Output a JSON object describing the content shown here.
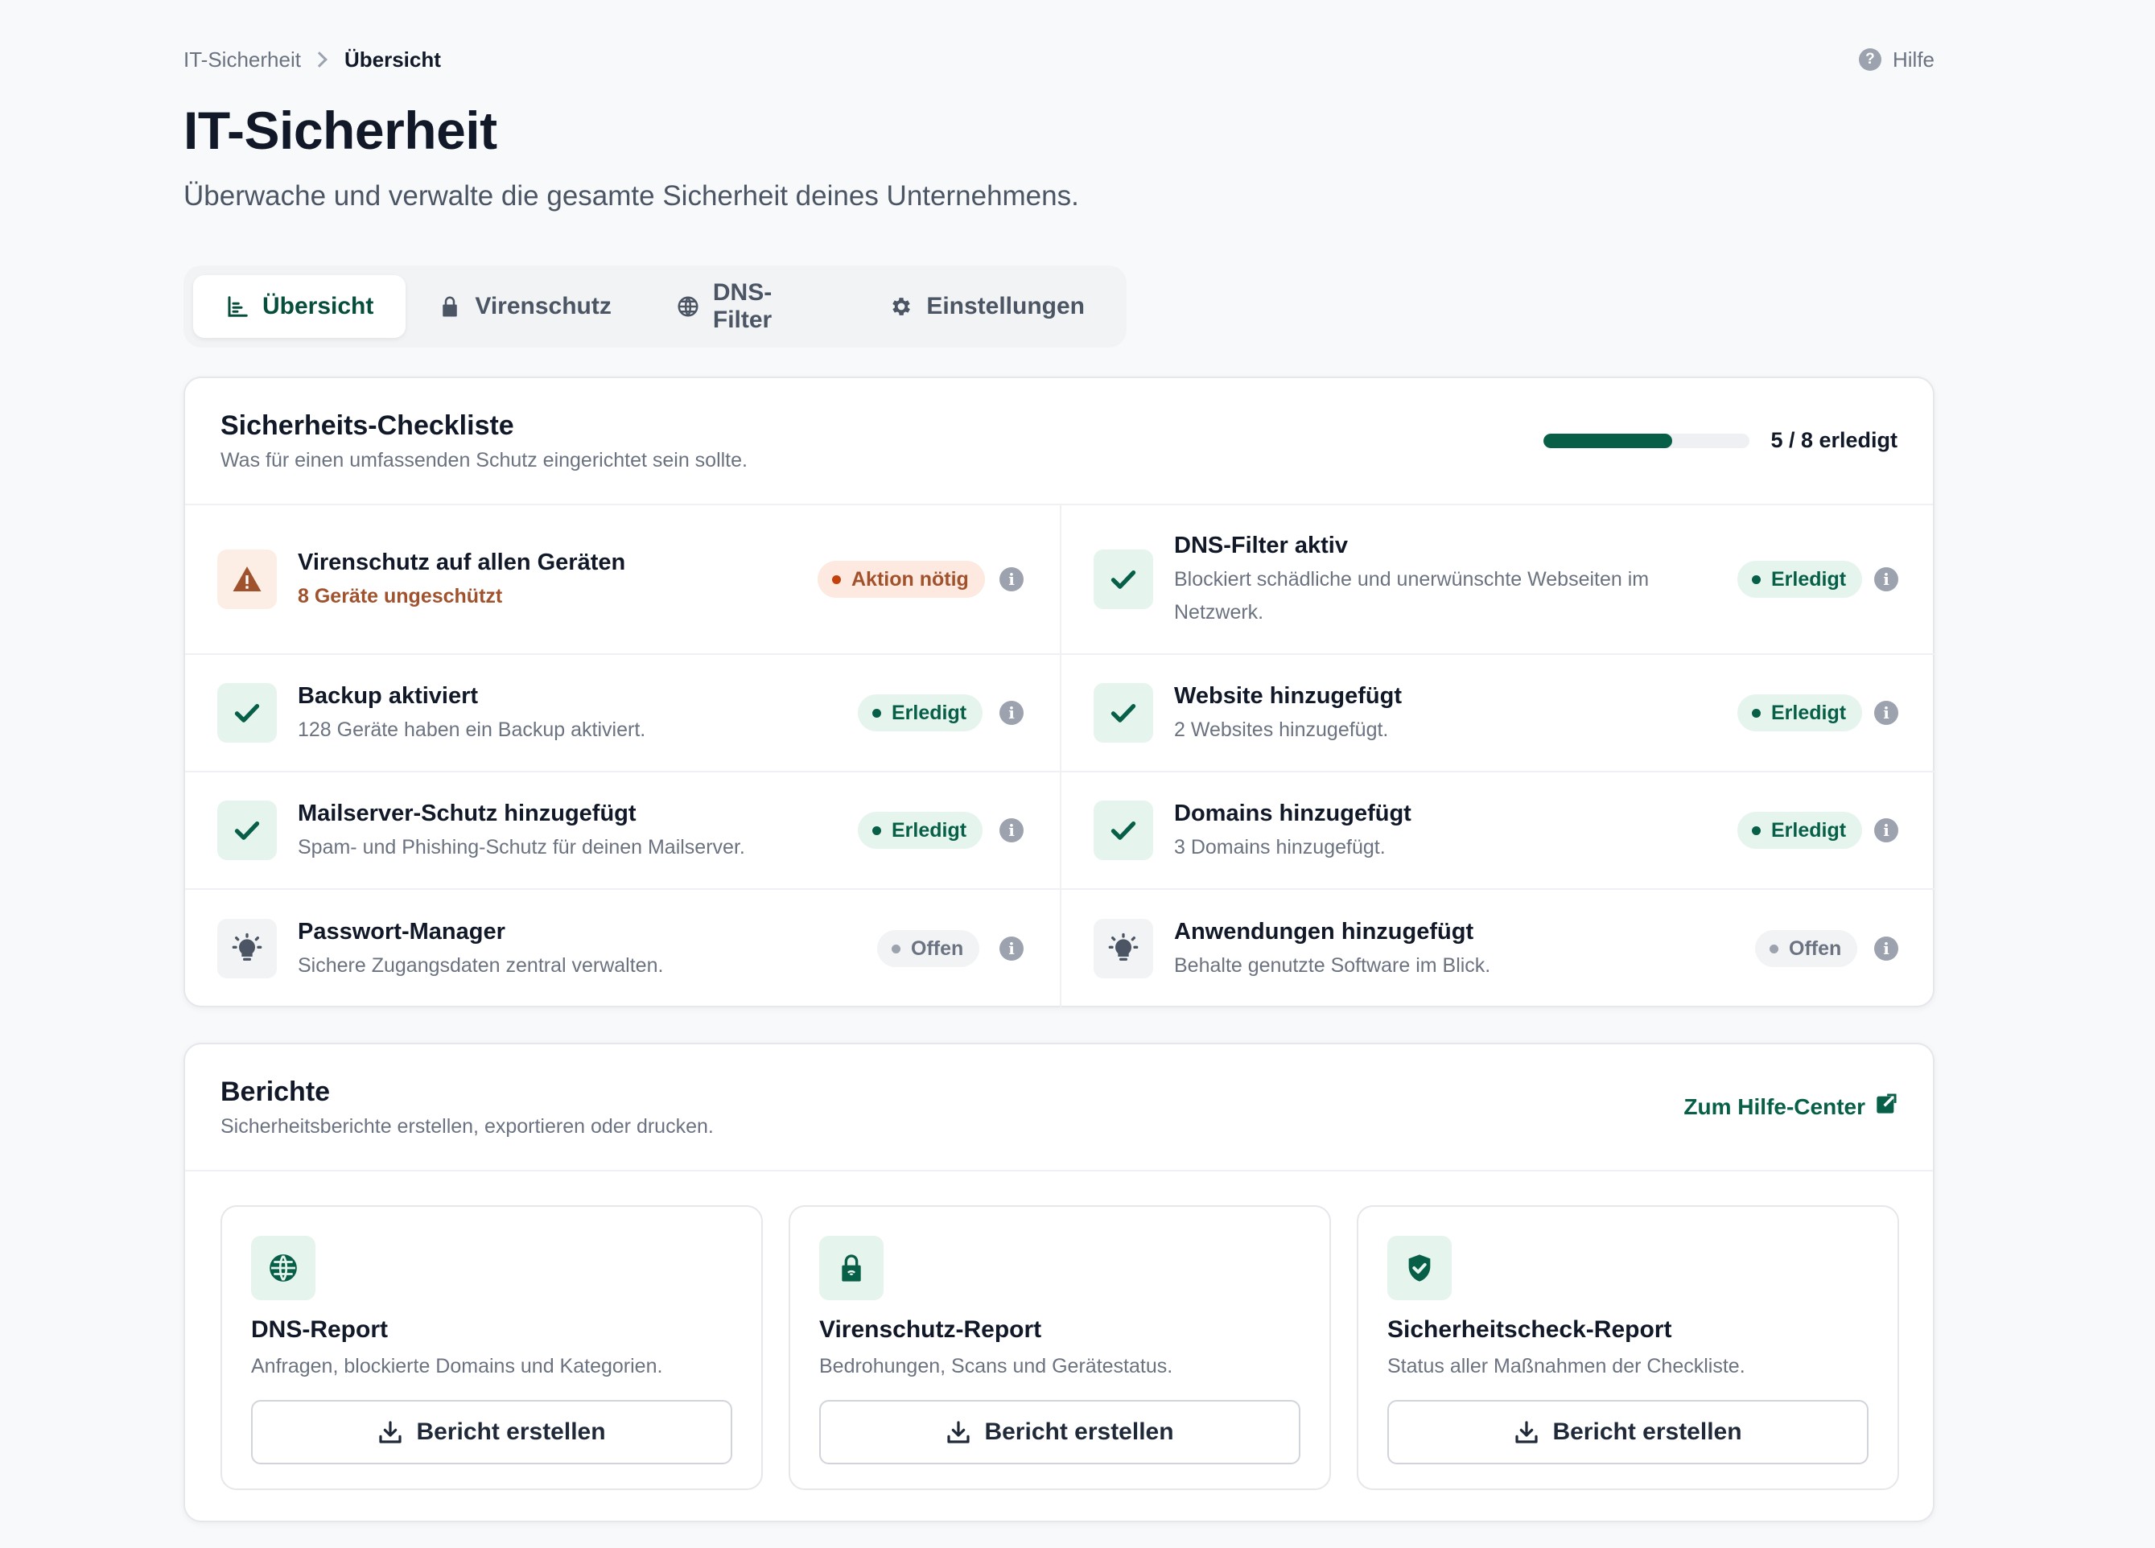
{
  "breadcrumb": {
    "parent": "IT-Sicherheit",
    "current": "Übersicht"
  },
  "help": {
    "label": "Hilfe"
  },
  "page": {
    "title": "IT-Sicherheit",
    "subtitle": "Überwache und verwalte die gesamte Sicherheit deines Unternehmens."
  },
  "tabs": [
    {
      "label": "Übersicht",
      "icon": "chart-bars-icon",
      "active": true
    },
    {
      "label": "Virenschutz",
      "icon": "lock-icon",
      "active": false
    },
    {
      "label": "DNS-Filter",
      "icon": "globe-icon",
      "active": false
    },
    {
      "label": "Einstellungen",
      "icon": "gear-icon",
      "active": false
    }
  ],
  "checklist": {
    "title": "Sicherheits-Checkliste",
    "description": "Was für einen umfassenden Schutz eingerichtet sein sollte.",
    "progress": {
      "done": 5,
      "total": 8,
      "label": "5 / 8 erledigt"
    },
    "items": [
      {
        "title": "Virenschutz auf allen Geräten",
        "desc": "8 Geräte ungeschützt",
        "status": "warn",
        "badge": "Aktion nötig",
        "icon": "warning-icon"
      },
      {
        "title": "DNS-Filter aktiv",
        "desc": "Blockiert schädliche und unerwünschte Webseiten im Netzwerk.",
        "status": "done",
        "badge": "Erledigt",
        "icon": "check-icon"
      },
      {
        "title": "Backup aktiviert",
        "desc": "128 Geräte haben ein Backup aktiviert.",
        "status": "done",
        "badge": "Erledigt",
        "icon": "check-icon"
      },
      {
        "title": "Website hinzugefügt",
        "desc": "2 Websites hinzugefügt.",
        "status": "done",
        "badge": "Erledigt",
        "icon": "check-icon"
      },
      {
        "title": "Mailserver-Schutz hinzugefügt",
        "desc": "Spam- und Phishing-Schutz für deinen Mailserver.",
        "status": "done",
        "badge": "Erledigt",
        "icon": "check-icon"
      },
      {
        "title": "Domains hinzugefügt",
        "desc": "3 Domains hinzugefügt.",
        "status": "done",
        "badge": "Erledigt",
        "icon": "check-icon"
      },
      {
        "title": "Passwort-Manager",
        "desc": "Sichere Zugangsdaten zentral verwalten.",
        "status": "open",
        "badge": "Offen",
        "icon": "lightbulb-icon"
      },
      {
        "title": "Anwendungen hinzugefügt",
        "desc": "Behalte genutzte Software im Blick.",
        "status": "open",
        "badge": "Offen",
        "icon": "lightbulb-icon"
      }
    ]
  },
  "reports": {
    "title": "Berichte",
    "description": "Sicherheitsberichte erstellen, exportieren oder drucken.",
    "help_link": "Zum Hilfe-Center",
    "cards": [
      {
        "title": "DNS-Report",
        "desc": "Anfragen, blockierte Domains und Kategorien.",
        "button": "Bericht erstellen",
        "icon": "globe-icon"
      },
      {
        "title": "Virenschutz-Report",
        "desc": "Bedrohungen, Scans und Gerätestatus.",
        "button": "Bericht erstellen",
        "icon": "lock-icon"
      },
      {
        "title": "Sicherheitscheck-Report",
        "desc": "Status aller Maßnahmen der Checkliste.",
        "button": "Bericht erstellen",
        "icon": "shield-check-icon"
      }
    ]
  },
  "colors": {
    "accent": "#065f46",
    "accent_soft": "#e6f4ee",
    "warning": "#a0522d",
    "warning_soft": "#fde9df",
    "muted": "#9ca3af"
  }
}
